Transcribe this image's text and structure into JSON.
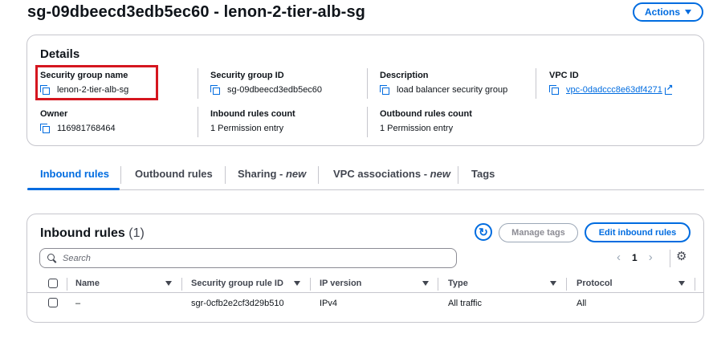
{
  "page": {
    "title": "sg-09dbeecd3edb5ec60 - lenon-2-tier-alb-sg",
    "actions_label": "Actions"
  },
  "details": {
    "heading": "Details",
    "fields": {
      "sg_name": {
        "label": "Security group name",
        "value": "lenon-2-tier-alb-sg"
      },
      "sg_id": {
        "label": "Security group ID",
        "value": "sg-09dbeecd3edb5ec60"
      },
      "description": {
        "label": "Description",
        "value": "load balancer security group"
      },
      "vpc_id": {
        "label": "VPC ID",
        "value": "vpc-0dadccc8e63df4271"
      },
      "owner": {
        "label": "Owner",
        "value": "116981768464"
      },
      "inbound_count": {
        "label": "Inbound rules count",
        "value": "1 Permission entry"
      },
      "outbound_count": {
        "label": "Outbound rules count",
        "value": "1 Permission entry"
      }
    },
    "highlight_color": "#d5161f"
  },
  "tabs": [
    {
      "label": "Inbound rules",
      "suffix": "",
      "active": true
    },
    {
      "label": "Outbound rules",
      "suffix": "",
      "active": false
    },
    {
      "label": "Sharing - ",
      "suffix": "new",
      "active": false
    },
    {
      "label": "VPC associations - ",
      "suffix": "new",
      "active": false
    },
    {
      "label": "Tags",
      "suffix": "",
      "active": false
    }
  ],
  "inbound_rules": {
    "heading": "Inbound rules",
    "count": "(1)",
    "manage_tags_label": "Manage tags",
    "edit_label": "Edit inbound rules",
    "search_placeholder": "Search",
    "current_page": "1",
    "columns": [
      "Name",
      "Security group rule ID",
      "IP version",
      "Type",
      "Protocol"
    ],
    "rows": [
      {
        "name": "–",
        "rule_id": "sgr-0cfb2e2cf3d29b510",
        "ip_version": "IPv4",
        "type": "All traffic",
        "protocol": "All"
      }
    ]
  },
  "colors": {
    "accent": "#006ce0",
    "text": "#0f141a",
    "border": "#c6c6cd"
  }
}
